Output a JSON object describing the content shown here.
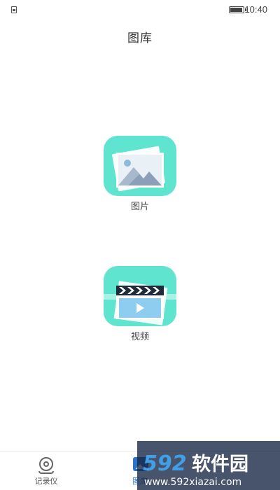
{
  "status_bar": {
    "time": "10:40",
    "left_icon": "sim-icon",
    "battery_icon": "battery-icon"
  },
  "header": {
    "title": "图库"
  },
  "tiles": [
    {
      "label": "图片",
      "icon": "photo-gallery-icon"
    },
    {
      "label": "视频",
      "icon": "video-clapper-icon"
    }
  ],
  "bottom_nav": {
    "items": [
      {
        "label": "记录仪",
        "icon": "camera-recorder-icon",
        "active": false
      },
      {
        "label": "图库",
        "icon": "gallery-icon",
        "active": true
      }
    ]
  },
  "watermark": {
    "brand": "592软件园",
    "url": "www.592xiazai.com"
  },
  "colors": {
    "tile_bg": "#5fe5cf",
    "active_nav": "#2d73c7"
  }
}
